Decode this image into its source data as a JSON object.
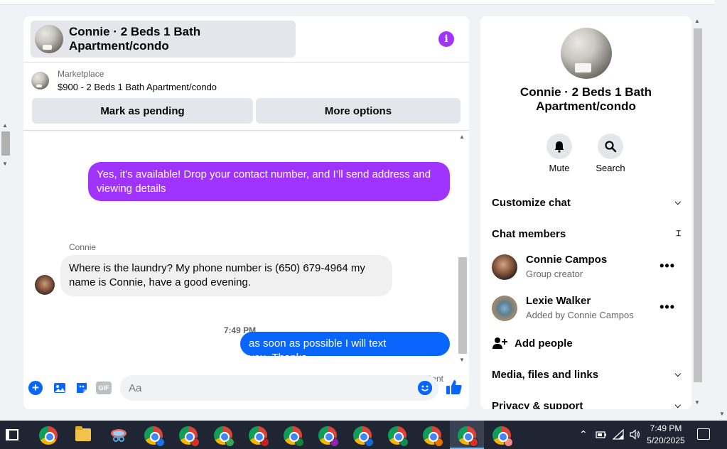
{
  "chat": {
    "title": "Connie · 2 Beds 1 Bath Apartment/condo",
    "marketplace_label": "Marketplace",
    "listing": "$900 - 2 Beds 1 Bath Apartment/condo",
    "mark_pending": "Mark as pending",
    "more_options": "More options",
    "info_glyph": "i",
    "messages": [
      {
        "direction": "out",
        "color": "#a033ff",
        "text": "Yes, it's available! Drop your contact number, and I’ll send address and viewing details"
      },
      {
        "direction": "in",
        "sender": "Connie",
        "text": "Where is the laundry? My phone number is (650) 679-4964 my name is Connie, have a good evening."
      },
      {
        "direction": "out",
        "color": "#0866ff",
        "text": "as soon as possible I will text you..Thanks"
      }
    ],
    "timestamp": "7:49 PM",
    "status": "Sent",
    "composer": {
      "placeholder": "Aa",
      "gif_label": "GIF",
      "icons": [
        "plus-icon",
        "photo-icon",
        "sticker-icon",
        "gif-icon",
        "emoji-icon",
        "like-icon"
      ]
    }
  },
  "side": {
    "title": "Connie · 2 Beds 1 Bath Apartment/condo",
    "mute": "Mute",
    "search": "Search",
    "customize": "Customize chat",
    "members_label": "Chat members",
    "members": [
      {
        "name": "Connie Campos",
        "role": "Group creator"
      },
      {
        "name": "Lexie Walker",
        "role": "Added by Connie Campos"
      }
    ],
    "more_glyph": "•••",
    "add_people": "Add people",
    "media": "Media, files and links",
    "privacy": "Privacy & support"
  },
  "taskbar": {
    "time": "7:49 PM",
    "date": "5/20/2025"
  },
  "colors": {
    "accent_purple": "#a033ff",
    "messenger_blue": "#0866ff"
  }
}
